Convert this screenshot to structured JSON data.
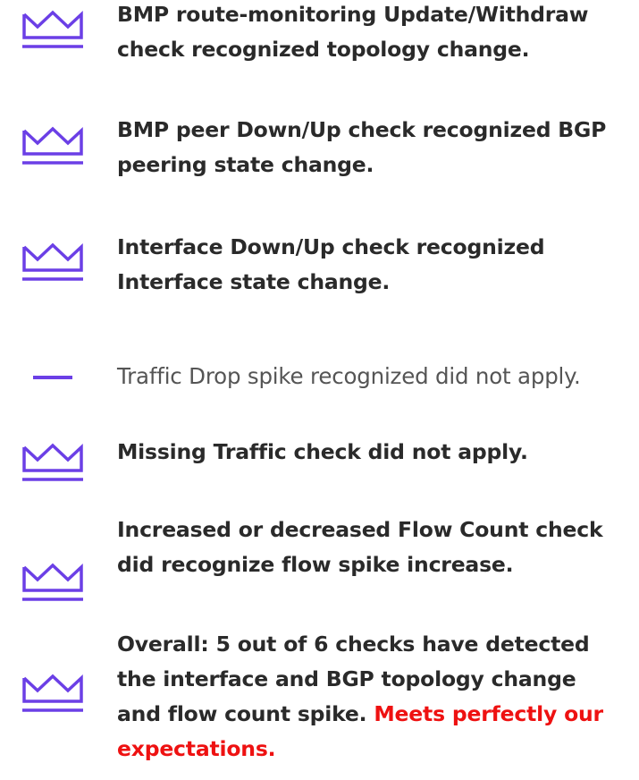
{
  "accent_color": "#6b3fe6",
  "highlight_color": "#ee1111",
  "items": [
    {
      "icon": "crown-icon",
      "lines": [
        "BMP route-monitoring Update/Withdraw",
        "check recognized topology change."
      ]
    },
    {
      "icon": "crown-icon",
      "lines": [
        "BMP peer Down/Up check recognized BGP",
        "peering state change."
      ]
    },
    {
      "icon": "crown-icon",
      "lines": [
        "Interface Down/Up check recognized",
        "Interface state change."
      ]
    },
    {
      "icon": "dash-icon",
      "lines": [
        "Traffic Drop spike recognized did not apply."
      ]
    },
    {
      "icon": "crown-icon",
      "lines": [
        "Missing Traffic check did not apply."
      ]
    },
    {
      "icon": "crown-icon",
      "lines": [
        "Increased or decreased Flow Count check",
        "did recognize flow spike increase."
      ]
    },
    {
      "icon": "crown-icon",
      "lines": [
        "Overall: 5 out of 6 checks have detected",
        "the interface and BGP topology change",
        "and flow count spike. "
      ],
      "highlight_a": "Meets perfectly our",
      "highlight_b": "expectations."
    }
  ]
}
